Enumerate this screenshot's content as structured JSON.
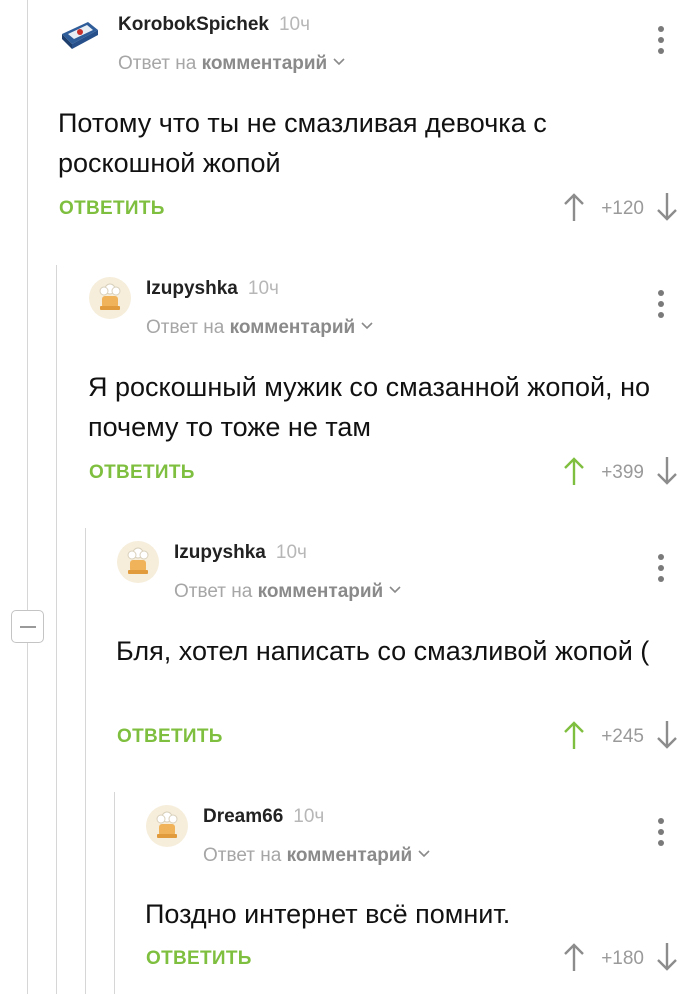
{
  "comments": [
    {
      "author": "KorobokSpichek",
      "time": "10ч",
      "reply_prefix": "Ответ на",
      "reply_target": "комментарий",
      "text": "Потому что ты не смазливая девочка с роскошной жопой",
      "reply_label": "ОТВЕТИТЬ",
      "score": "+120",
      "upvoted": false,
      "avatar": "matchbox-avatar"
    },
    {
      "author": "Izupyshka",
      "time": "10ч",
      "reply_prefix": "Ответ на",
      "reply_target": "комментарий",
      "text": "Я роскошный мужик со смазанной жопой, но почему то тоже не там",
      "reply_label": "ОТВЕТИТЬ",
      "score": "+399",
      "upvoted": true,
      "avatar": "default-chef-avatar"
    },
    {
      "author": "Izupyshka",
      "time": "10ч",
      "reply_prefix": "Ответ на",
      "reply_target": "комментарий",
      "text": "Бля, хотел написать со смазливой жопой (",
      "reply_label": "ОТВЕТИТЬ",
      "score": "+245",
      "upvoted": true,
      "avatar": "default-chef-avatar"
    },
    {
      "author": "Dream66",
      "time": "10ч",
      "reply_prefix": "Ответ на",
      "reply_target": "комментарий",
      "text": "Поздно интернет всё помнит.",
      "reply_label": "ОТВЕТИТЬ",
      "score": "+180",
      "upvoted": false,
      "avatar": "default-chef-avatar"
    }
  ],
  "colors": {
    "accent_green": "#7fbf3f",
    "muted_text": "#a6a6a6",
    "thread_line": "#d6d6d6",
    "vote_neutral": "#8c8c8c"
  },
  "icons": {
    "collapse": "minus-square-icon",
    "menu": "kebab-menu-icon",
    "upvote": "arrow-up-icon",
    "downvote": "arrow-down-icon",
    "dropdown": "chevron-down-icon"
  }
}
